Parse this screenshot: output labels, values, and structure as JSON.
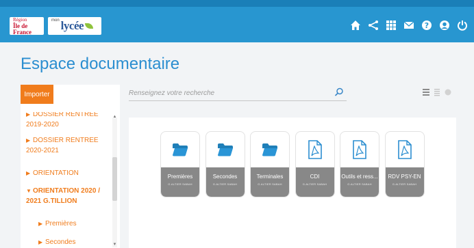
{
  "header": {
    "logo_region_line1": "Région",
    "logo_region_line2": "Île de France",
    "logo_lycee_prefix": "mon",
    "logo_lycee_name": "lycée",
    "icons": [
      "home-icon",
      "share-icon",
      "apps-grid-icon",
      "mail-icon",
      "help-icon",
      "user-icon",
      "power-icon"
    ],
    "color": "#2896d0"
  },
  "page": {
    "title": "Espace documentaire"
  },
  "sidebar": {
    "import_label": "Importer",
    "accent_color": "#f07c1c",
    "tree": [
      {
        "label": "DOSSIER RENTREE 2019-2020",
        "state": "collapsed"
      },
      {
        "label": "DOSSIER RENTREE 2020-2021",
        "state": "collapsed"
      },
      {
        "label": "ORIENTATION",
        "state": "collapsed"
      },
      {
        "label": "ORIENTATION 2020 / 2021 G.TILLION",
        "state": "expanded"
      },
      {
        "label": "Premières",
        "state": "child"
      },
      {
        "label": "Secondes",
        "state": "child"
      }
    ]
  },
  "search": {
    "placeholder": "Renseignez votre recherche"
  },
  "view_icons": [
    "list-view-icon",
    "detail-view-icon",
    "grid-view-icon"
  ],
  "items": [
    {
      "name": "Premières",
      "type": "folder",
      "author": "G.ALTIER SABAH"
    },
    {
      "name": "Secondes",
      "type": "folder",
      "author": "G.ALTIER SABAH"
    },
    {
      "name": "Terminales",
      "type": "folder",
      "author": "G.ALTIER SABAH"
    },
    {
      "name": "CDI",
      "type": "pdf",
      "author": "G.ALTIER SABAH"
    },
    {
      "name": "Outils et ress...",
      "type": "pdf",
      "author": "G.ALTIER SABAH"
    },
    {
      "name": "RDV PSY-EN",
      "type": "pdf",
      "author": "G.ALTIER SABAH"
    }
  ]
}
